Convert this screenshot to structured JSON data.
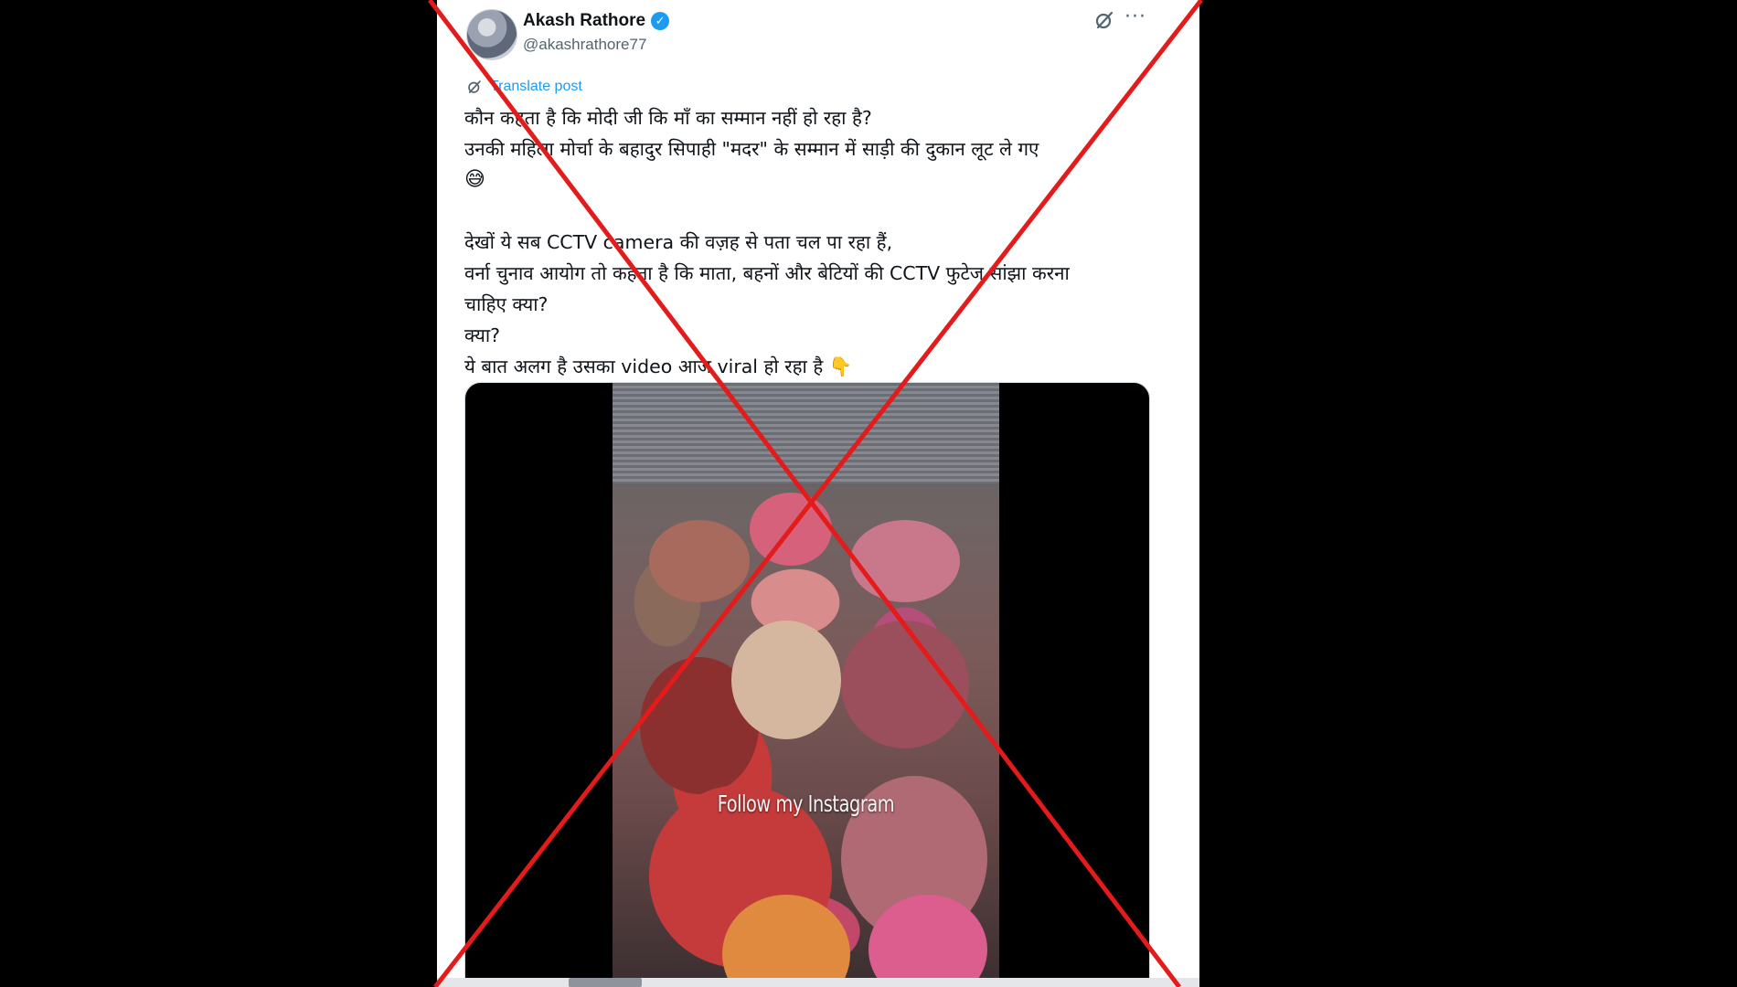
{
  "post": {
    "author_name": "Akash Rathore",
    "handle": "@akashrathore77",
    "translate_label": "Translate post",
    "lines": [
      "कौन कहता है कि मोदी जी कि माँ का सम्मान नहीं हो रहा है?",
      "उनकी महिला मोर्चा के बहादुर सिपाही \"मदर\" के सम्मान में साड़ी की दुकान लूट ले गए",
      "😅",
      "",
      "देखों ये सब CCTV camera की वज़ह से पता चल पा रहा हैं,",
      "वर्ना चुनाव आयोग तो कहता है कि माता, बहनों और बेटियों की CCTV फुटेज सांझा करना",
      "चाहिए क्या?",
      "क्या?",
      "ये बात अलग है उसका video आज viral हो रहा है 👇"
    ],
    "media": {
      "watermark": "Follow my Instagram"
    }
  },
  "overlay": {
    "cross_color": "#e31b1b"
  },
  "icons": [
    "verified-badge-icon",
    "grok-icon",
    "more-options-icon",
    "translate-icon"
  ]
}
